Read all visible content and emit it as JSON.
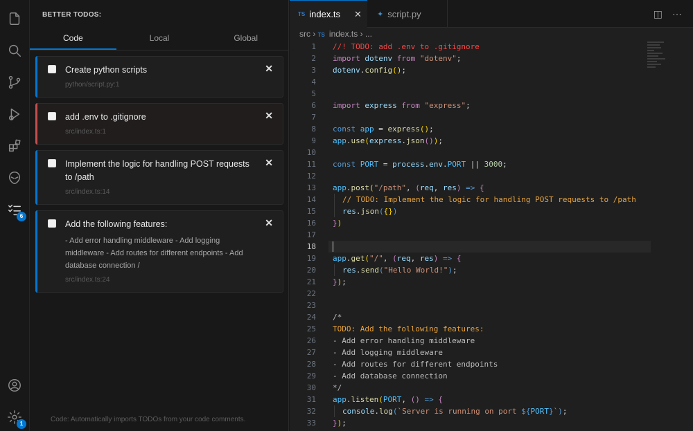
{
  "colors": {
    "accent": "#0078d4",
    "bar_blue": "#0078d4",
    "bar_red": "#c74e4e"
  },
  "activity_icons": [
    "files-icon",
    "search-icon",
    "source-control-icon",
    "run-debug-icon",
    "extensions-icon",
    "alien-icon",
    "todo-list-icon",
    "account-icon",
    "settings-gear-icon"
  ],
  "activity_badges": {
    "todos": "6",
    "settings": "1"
  },
  "sidebar": {
    "title": "BETTER TODOS:",
    "tabs": [
      "Code",
      "Local",
      "Global"
    ],
    "todos": [
      {
        "title": "Create python scripts",
        "location": "python/script.py:1"
      },
      {
        "title": "add .env to .gitignore",
        "location": "src/index.ts:1"
      },
      {
        "title": "Implement the logic for handling POST requests to /path",
        "location": "src/index.ts:14"
      },
      {
        "title": "Add the following features:",
        "description": "- Add error handling middleware - Add logging middleware - Add routes for different endpoints - Add database connection /",
        "location": "src/index.ts:24"
      }
    ],
    "footer": "Code: Automatically imports TODOs from your code comments."
  },
  "editor": {
    "tabs": [
      {
        "label": "index.ts",
        "badge": "TS"
      },
      {
        "label": "script.py"
      }
    ],
    "breadcrumb": {
      "folder": "src",
      "badge": "TS",
      "file": "index.ts",
      "more": "..."
    },
    "line_numbers": [
      "1",
      "2",
      "3",
      "4",
      "5",
      "6",
      "7",
      "8",
      "9",
      "10",
      "11",
      "12",
      "13",
      "14",
      "15",
      "16",
      "17",
      "18",
      "19",
      "20",
      "21",
      "22",
      "23",
      "24",
      "25",
      "26",
      "27",
      "28",
      "29",
      "30",
      "31",
      "32",
      "33"
    ],
    "code": {
      "l1": "//! TODO: add .env to .gitignore",
      "l24": "/*",
      "l25": "TODO: Add the following features:",
      "l26": "- Add error handling middleware",
      "l27": "- Add logging middleware",
      "l28": "- Add routes for different endpoints",
      "l29": "- Add database connection",
      "l30": "*/",
      "l14_comment": "// TODO: Implement the logic for handling POST requests to /path"
    }
  }
}
